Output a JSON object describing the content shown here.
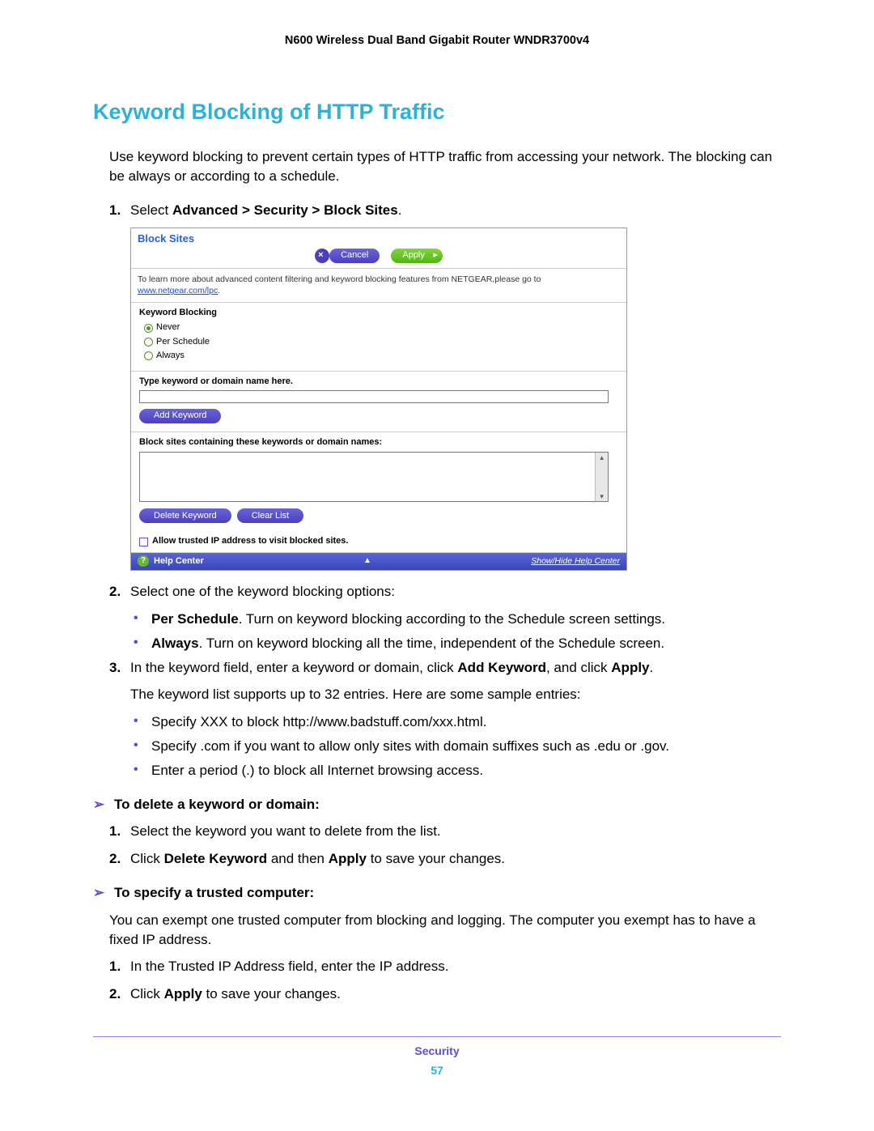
{
  "header": {
    "product": "N600 Wireless Dual Band Gigabit Router WNDR3700v4"
  },
  "title": "Keyword Blocking of HTTP Traffic",
  "intro": "Use keyword blocking to prevent certain types of HTTP traffic from accessing your network. The blocking can be always or according to a schedule.",
  "steps": {
    "s1": {
      "num": "1.",
      "prefix": "Select ",
      "bold": "Advanced > Security > Block Sites",
      "suffix": "."
    },
    "s2": {
      "num": "2.",
      "text": "Select one of the keyword blocking options:"
    },
    "s2b1": {
      "bold": "Per Schedule",
      "text": ". Turn on keyword blocking according to the Schedule screen settings."
    },
    "s2b2": {
      "bold": "Always",
      "text": ". Turn on keyword blocking all the time, independent of the Schedule screen."
    },
    "s3": {
      "num": "3.",
      "pre": "In the keyword field, enter a keyword or domain, click ",
      "b1": "Add Keyword",
      "mid": ", and click ",
      "b2": "Apply",
      "post": "."
    },
    "s3note": "The keyword list supports up to 32 entries. Here are some sample entries:",
    "s3b1": "Specify XXX to block http://www.badstuff.com/xxx.html.",
    "s3b2": "Specify .com if you want to allow only sites with domain suffixes such as .edu or .gov.",
    "s3b3": "Enter a period (.) to block all Internet browsing access."
  },
  "del": {
    "heading": "To delete a keyword or domain:",
    "s1": {
      "num": "1.",
      "text": "Select the keyword you want to delete from the list."
    },
    "s2": {
      "num": "2.",
      "pre": "Click ",
      "b1": "Delete Keyword",
      "mid": " and then ",
      "b2": "Apply",
      "post": " to save your changes."
    }
  },
  "trust": {
    "heading": "To specify a trusted computer:",
    "intro": "You can exempt one trusted computer from blocking and logging. The computer you exempt has to have a fixed IP address.",
    "s1": {
      "num": "1.",
      "text": "In the Trusted IP Address field, enter the IP address."
    },
    "s2": {
      "num": "2.",
      "pre": "Click ",
      "b1": "Apply",
      "post": " to save your changes."
    }
  },
  "ui": {
    "title": "Block Sites",
    "cancel": "Cancel",
    "apply": "Apply",
    "info_pre": "To learn more about advanced content filtering and keyword blocking features from NETGEAR,please go to ",
    "info_link": "www.netgear.com/lpc",
    "info_post": ".",
    "kb_label": "Keyword Blocking",
    "r_never": "Never",
    "r_sched": "Per Schedule",
    "r_always": "Always",
    "type_label": "Type keyword or domain name here.",
    "add_kw": "Add Keyword",
    "list_label": "Block sites containing these keywords or domain names:",
    "del_kw": "Delete Keyword",
    "clear": "Clear List",
    "allow_chk": "Allow trusted IP address to visit blocked sites.",
    "help": "Help Center",
    "help_link": "Show/Hide Help Center"
  },
  "footer": {
    "category": "Security",
    "page": "57"
  }
}
